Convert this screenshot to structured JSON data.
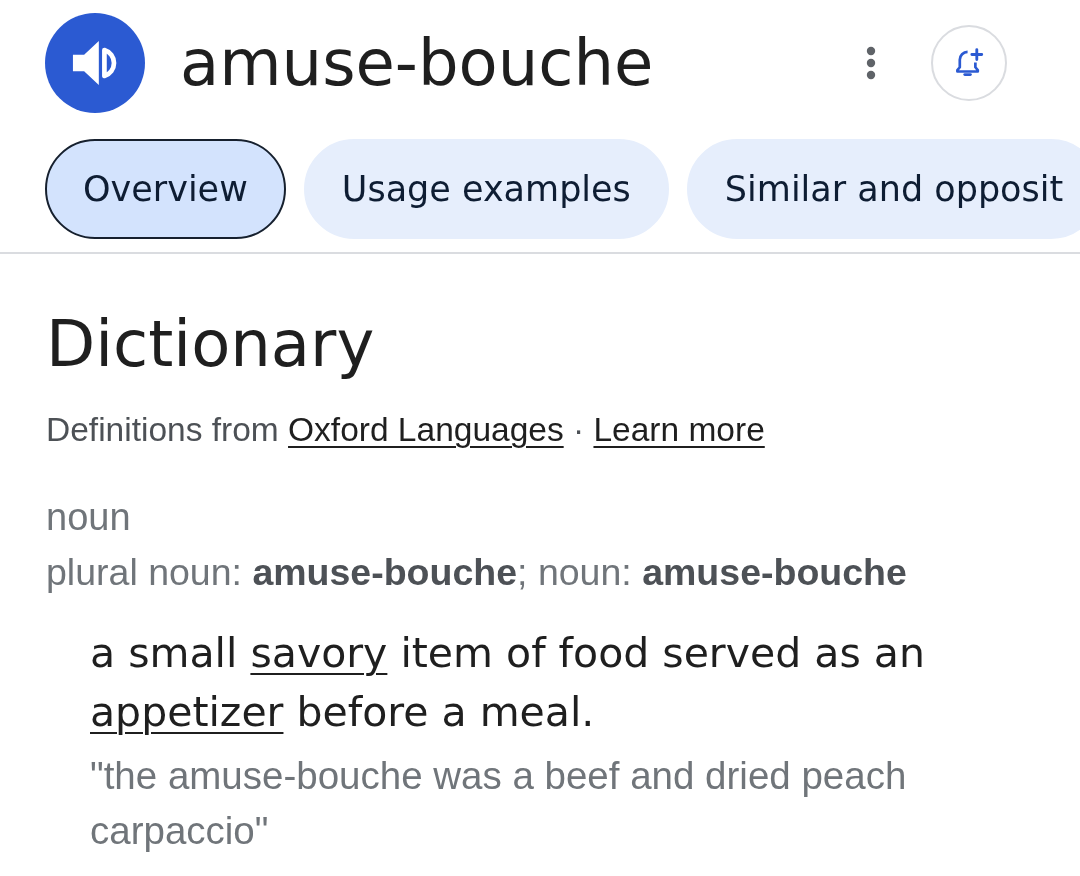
{
  "header": {
    "word": "amuse-bouche"
  },
  "tabs": [
    {
      "label": "Overview",
      "selected": true
    },
    {
      "label": "Usage examples",
      "selected": false
    },
    {
      "label": "Similar and opposit",
      "selected": false
    }
  ],
  "dictionary": {
    "title": "Dictionary",
    "source": [
      {
        "kind": "text",
        "text": "Definitions from "
      },
      {
        "kind": "link",
        "text": "Oxford Languages"
      },
      {
        "kind": "text",
        "text": " · "
      },
      {
        "kind": "link",
        "text": "Learn more"
      }
    ]
  },
  "entry": {
    "part_of_speech": "noun",
    "inflections": "plural noun: **amuse-bouche**; noun: **amuse-bouche**",
    "definition": [
      {
        "kind": "text",
        "text": "a small "
      },
      {
        "kind": "link",
        "text": "savory"
      },
      {
        "kind": "text",
        "text": " item of food served as an "
      },
      {
        "kind": "link",
        "text": "appetizer"
      },
      {
        "kind": "text",
        "text": " before a meal."
      }
    ],
    "example": "\"the amuse-bouche was a beef and dried peach carpaccio\""
  }
}
